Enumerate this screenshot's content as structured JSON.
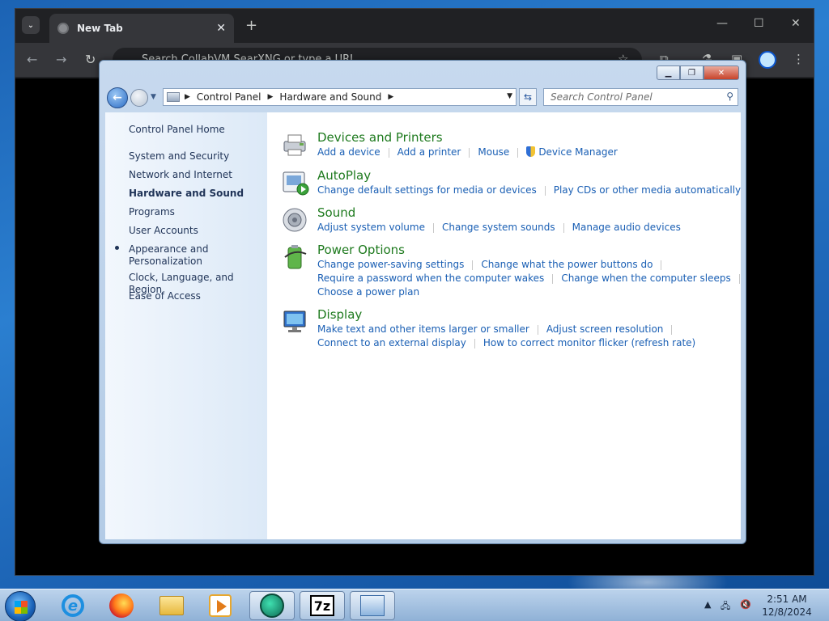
{
  "browser": {
    "tab_title": "New Tab",
    "close_glyph": "✕",
    "new_tab_glyph": "+",
    "omnibox_text": "Search CollabVM SearXNG or type a URL",
    "window_controls": {
      "minimize": "—",
      "maximize": "☐",
      "close": "✕"
    },
    "nav": {
      "back": "←",
      "forward": "→",
      "reload": "↻"
    }
  },
  "window": {
    "controls": {
      "minimize": "▁",
      "maximize": "❐",
      "close": "✕"
    }
  },
  "address_bar": {
    "crumbs": [
      "Control Panel",
      "Hardware and Sound"
    ],
    "separator": "▶",
    "dropdown": "▼",
    "refresh": "⇆"
  },
  "search": {
    "placeholder": "Search Control Panel",
    "icon": "⚲"
  },
  "left_nav": {
    "home": "Control Panel Home",
    "items": [
      "System and Security",
      "Network and Internet",
      "Hardware and Sound",
      "Programs",
      "User Accounts",
      "Appearance and",
      "Personalization",
      "Clock, Language, and Region",
      "Ease of Access"
    ],
    "active_index": 2
  },
  "categories": [
    {
      "title": "Devices and Printers",
      "icon": "printer-icon",
      "links": [
        [
          "Add a device",
          "Add a printer",
          "Mouse",
          "Device Manager"
        ]
      ]
    },
    {
      "title": "AutoPlay",
      "icon": "autoplay-icon",
      "links": [
        [
          "Change default settings for media or devices",
          "Play CDs or other media automatically"
        ]
      ]
    },
    {
      "title": "Sound",
      "icon": "speaker-icon",
      "links": [
        [
          "Adjust system volume",
          "Change system sounds",
          "Manage audio devices"
        ]
      ]
    },
    {
      "title": "Power Options",
      "icon": "battery-icon",
      "links": [
        [
          "Change power-saving settings",
          "Change what the power buttons do"
        ],
        [
          "Require a password when the computer wakes",
          "Change when the computer sleeps"
        ],
        [
          "Choose a power plan"
        ]
      ]
    },
    {
      "title": "Display",
      "icon": "monitor-icon",
      "links": [
        [
          "Make text and other items larger or smaller",
          "Adjust screen resolution"
        ],
        [
          "Connect to an external display",
          "How to correct monitor flicker (refresh rate)"
        ]
      ]
    }
  ],
  "taskbar": {
    "sevenzip_label": "7z",
    "tray_arrow": "▲",
    "time": "2:51 AM",
    "date": "12/8/2024"
  },
  "colors": {
    "category_heading": "#1e7a1e",
    "link": "#1a5fb4",
    "nav_text": "#1f3357"
  }
}
